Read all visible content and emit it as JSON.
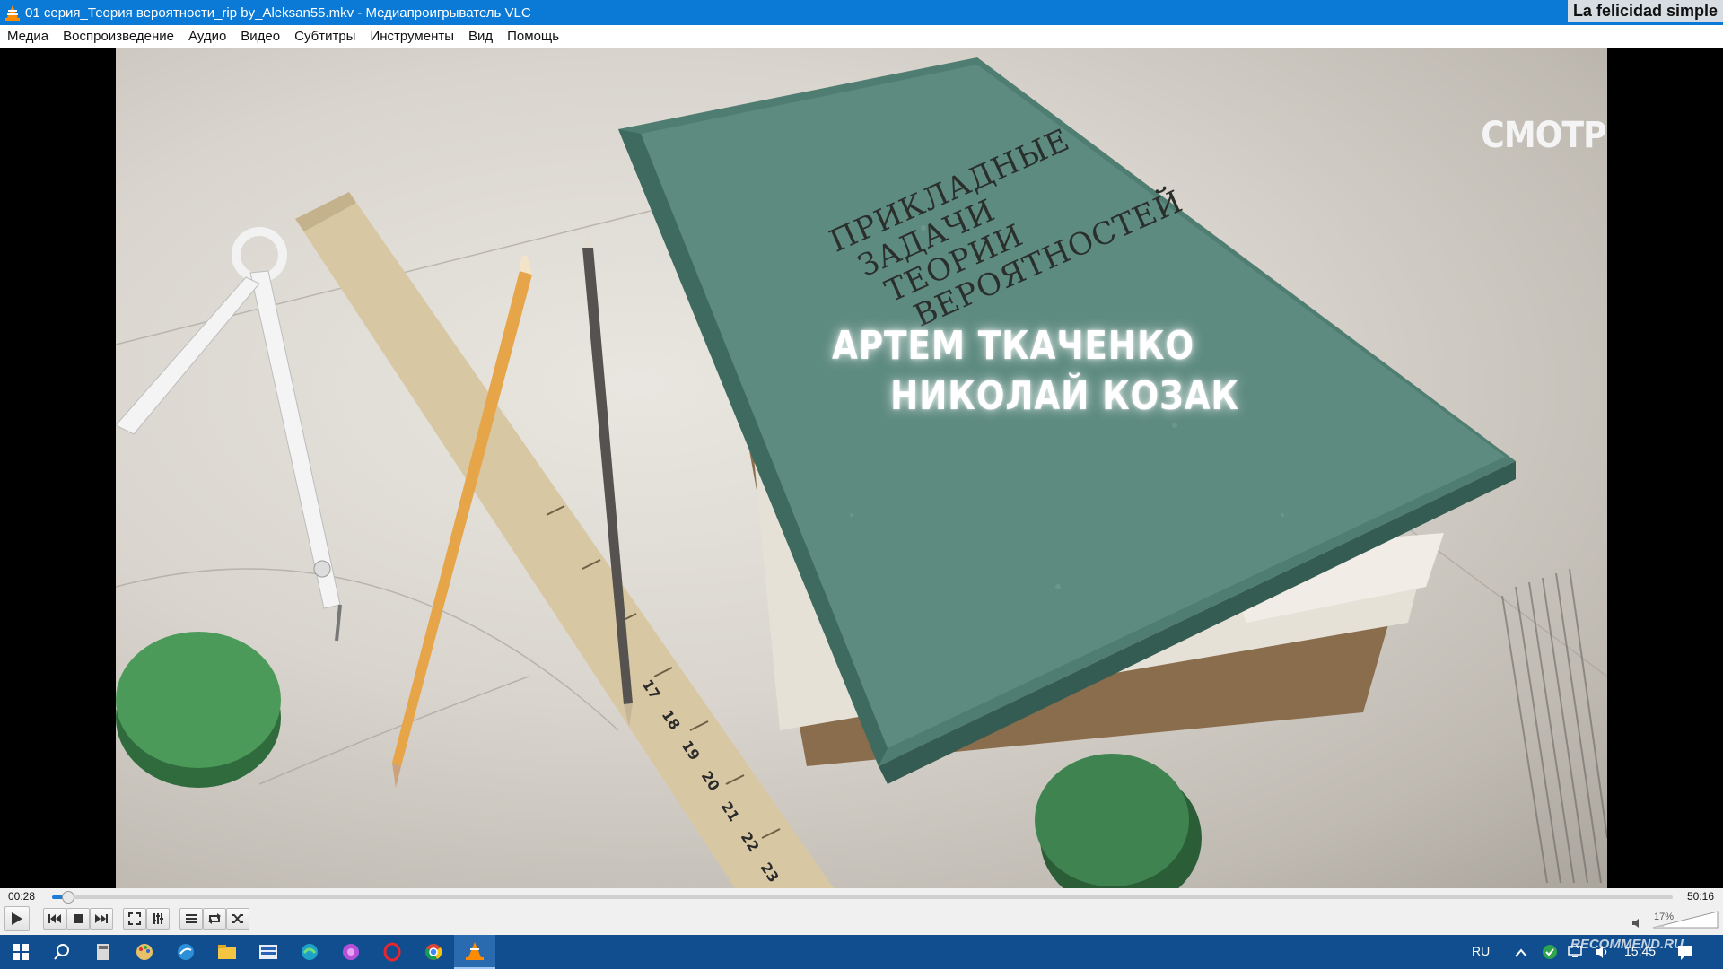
{
  "window": {
    "title": "01 серия_Теория вероятности_rip by_Aleksan55.mkv - Медиапроигрыватель VLC",
    "corner_tag": "La felicidad simple"
  },
  "menu": {
    "items": [
      "Медиа",
      "Воспроизведение",
      "Аудио",
      "Видео",
      "Субтитры",
      "Инструменты",
      "Вид",
      "Помощь"
    ]
  },
  "video": {
    "book_title_lines": [
      "ПРИКЛАДНЫЕ",
      "ЗАДАЧИ",
      "ТЕОРИИ",
      "ВЕРОЯТНОСТЕЙ"
    ],
    "credit_1": "АРТЕМ ТКАЧЕНКО",
    "credit_2": "НИКОЛАЙ КОЗАК",
    "channel_logo": "СМОТРИМ",
    "ruler_numbers": [
      "17",
      "18",
      "19",
      "20",
      "21",
      "22",
      "23"
    ]
  },
  "player": {
    "elapsed": "00:28",
    "total": "50:16",
    "progress": 0.0093,
    "volume_label": "17%",
    "volume": 0.17
  },
  "taskbar": {
    "language": "RU",
    "clock": "15:45",
    "watermark": "RECOMMEND.RU"
  },
  "colors": {
    "titlebar": "#0a7ad6",
    "taskbar": "#104e8f",
    "seek_fill": "#1c7ed6",
    "book_cover": "#5e8b80"
  }
}
